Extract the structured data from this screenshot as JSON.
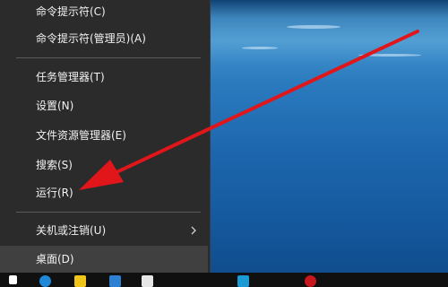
{
  "context_menu": {
    "items": [
      {
        "label": "命令提示符(C)"
      },
      {
        "label": "命令提示符(管理员)(A)"
      },
      {
        "label": "任务管理器(T)"
      },
      {
        "label": "设置(N)"
      },
      {
        "label": "文件资源管理器(E)"
      },
      {
        "label": "搜索(S)"
      },
      {
        "label": "运行(R)"
      },
      {
        "label": "关机或注销(U)",
        "has_submenu": true
      },
      {
        "label": "桌面(D)",
        "highlighted": true
      }
    ]
  },
  "annotation": {
    "type": "red-arrow",
    "color": "#e0161a",
    "points_to": "运行(R)"
  },
  "taskbar": {
    "icons": [
      "start-icon",
      "edge-icon",
      "file-explorer-icon",
      "store-icon",
      "mail-icon",
      "app-icon",
      "red-app-icon"
    ]
  },
  "colors": {
    "menu_bg": "#2b2b2b",
    "menu_text": "#f2f2f2",
    "hover_bg": "#404040",
    "arrow": "#e0161a"
  }
}
